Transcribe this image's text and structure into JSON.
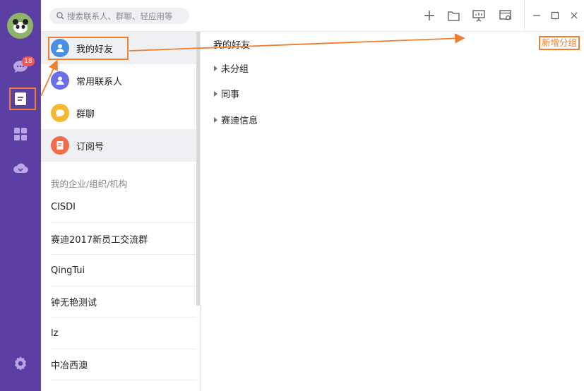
{
  "rail": {
    "badge_count": "18",
    "icons": [
      "avatar",
      "chat-icon",
      "contacts-icon",
      "apps-icon",
      "cloud-icon",
      "settings-icon"
    ]
  },
  "topbar": {
    "search_placeholder": "搜索联系人、群聊、轻应用等"
  },
  "contacts": {
    "categories": [
      {
        "label": "我的好友",
        "color": "#4a90e2"
      },
      {
        "label": "常用联系人",
        "color": "#6a6ee8"
      },
      {
        "label": "群聊",
        "color": "#f5b82e"
      },
      {
        "label": "订阅号",
        "color": "#f26b4b"
      }
    ],
    "section_header": "我的企业/组织/机构",
    "orgs": [
      "CISDI",
      "赛迪2017新员工交流群",
      "QingTui",
      "钟无艳测试",
      "lz",
      "中冶西澳"
    ]
  },
  "detail": {
    "title": "我的好友",
    "add_group_label": "新增分组",
    "groups": [
      "未分组",
      "同事",
      "赛迪信息"
    ]
  },
  "colors": {
    "rail_bg": "#5b3fa3",
    "highlight": "#ef7e2e",
    "badge": "#f25555"
  }
}
